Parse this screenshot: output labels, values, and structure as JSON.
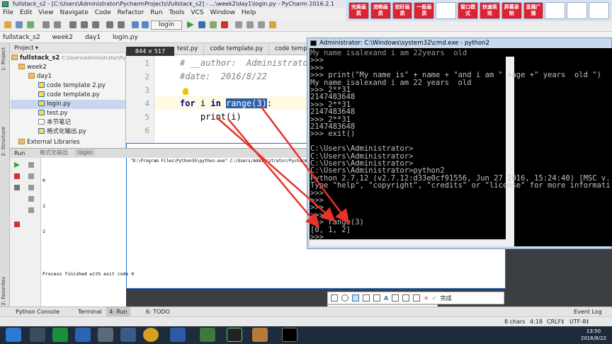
{
  "window_title": "fullstack_s2 - [C:\\Users\\Administrator\\PycharmProjects\\fullstack_s2] - ...\\week2\\day1\\login.py - PyCharm 2016.2.1",
  "menu": [
    "File",
    "Edit",
    "View",
    "Navigate",
    "Code",
    "Refactor",
    "Run",
    "Tools",
    "VCS",
    "Window",
    "Help"
  ],
  "ime_buttons": [
    "完美画质",
    "流畅画质",
    "较好画质",
    "一般画质",
    "",
    "窗口模式",
    "快速高效",
    "屏幕录制",
    "直播广播",
    "",
    "",
    ""
  ],
  "run_config": "login",
  "breadcrumb": [
    "fullstack_s2",
    "week2",
    "day1",
    "login.py"
  ],
  "project_panel": {
    "header": "Project",
    "tree": [
      {
        "label": "fullstack_s2",
        "suffix": "C:\\Users\\Administrator\\Pycharm",
        "type": "folder",
        "indent": 0
      },
      {
        "label": "week2",
        "type": "folder",
        "indent": 1
      },
      {
        "label": "day1",
        "type": "folder",
        "indent": 2
      },
      {
        "label": "code template 2.py",
        "type": "py",
        "indent": 3
      },
      {
        "label": "code template.py",
        "type": "py",
        "indent": 3
      },
      {
        "label": "login.py",
        "type": "py",
        "indent": 3,
        "selected": true
      },
      {
        "label": "test.py",
        "type": "py",
        "indent": 3
      },
      {
        "label": "本节笔记",
        "type": "txt",
        "indent": 3
      },
      {
        "label": "格式化输出.py",
        "type": "py",
        "indent": 3
      },
      {
        "label": "External Libraries",
        "type": "folder",
        "indent": 0
      }
    ]
  },
  "left_tool_tabs": [
    "1: Project",
    "2: Structure",
    "2: Favorites"
  ],
  "editor": {
    "tabs": [
      "test.py",
      "code template.py",
      "code template 2.py"
    ],
    "size_badge": "844 × 517",
    "line_numbers": [
      "1",
      "2",
      "3",
      "4",
      "5",
      "6"
    ],
    "lines": [
      {
        "comment": "# __author:  Administrator"
      },
      {
        "comment": "#date:  2016/8/22"
      },
      {
        "text": ""
      },
      {
        "kw1": "for",
        "mid": " i ",
        "kw2": "in",
        "hl": "range(3)",
        "tail": ":"
      },
      {
        "text": "    print(i)"
      },
      {
        "text": ""
      }
    ]
  },
  "run_panel": {
    "header": "Run",
    "tabs": [
      "格式化输出",
      "login"
    ],
    "command": "\"D:\\Program Files\\Python35\\python.exe\" C:/Users/Administrator/PycharmProjects/fullstack_s2/week2/d",
    "output": [
      "0",
      "1",
      "2",
      "",
      "Process finished with exit code 0"
    ]
  },
  "cmd_window": {
    "title": "Administrator: C:\\Windows\\system32\\cmd.exe - python2",
    "lines": [
      "My name isalexand i am 22years  old",
      ">>>",
      ">>>",
      ">>> print(\"My name is\" + name + \"and i am \" +age +\" years  old \")",
      "My name isalexand i am 22 years  old",
      ">>> 2**31",
      "2147483648",
      ">>> 2**31",
      "2147483648",
      ">>> 2**31",
      "2147483648",
      ">>> exit()",
      "",
      "C:\\Users\\Administrator>",
      "C:\\Users\\Administrator>",
      "C:\\Users\\Administrator>",
      "C:\\Users\\Administrator>python2",
      "Python 2.7.12 (v2.7.12:d33e0cf91556, Jun 27 2016, 15:24:40) [MSC v.",
      "Type \"help\", \"copyright\", \"credits\" or \"license\" for more informati",
      ">>>",
      ">>>",
      ">>>",
      ">>>",
      ">>> range(3)",
      "[0, 1, 2]",
      ">>>"
    ]
  },
  "shot_toolbar": {
    "done_label": "完成"
  },
  "tool_tabs": [
    "Python Console",
    "Terminal",
    "4: Run",
    "6: TODO"
  ],
  "event_log": "Event Log",
  "status": {
    "chars": "8 chars",
    "position": "4:18",
    "line_sep": "CRLF‡",
    "encoding": "UTF-8‡"
  },
  "clock": {
    "time": "13:50",
    "date": "2016/8/22"
  },
  "colors": {
    "arrow": "#e8322b",
    "selection": "#2d5fa8",
    "console_bg": "#000000"
  }
}
